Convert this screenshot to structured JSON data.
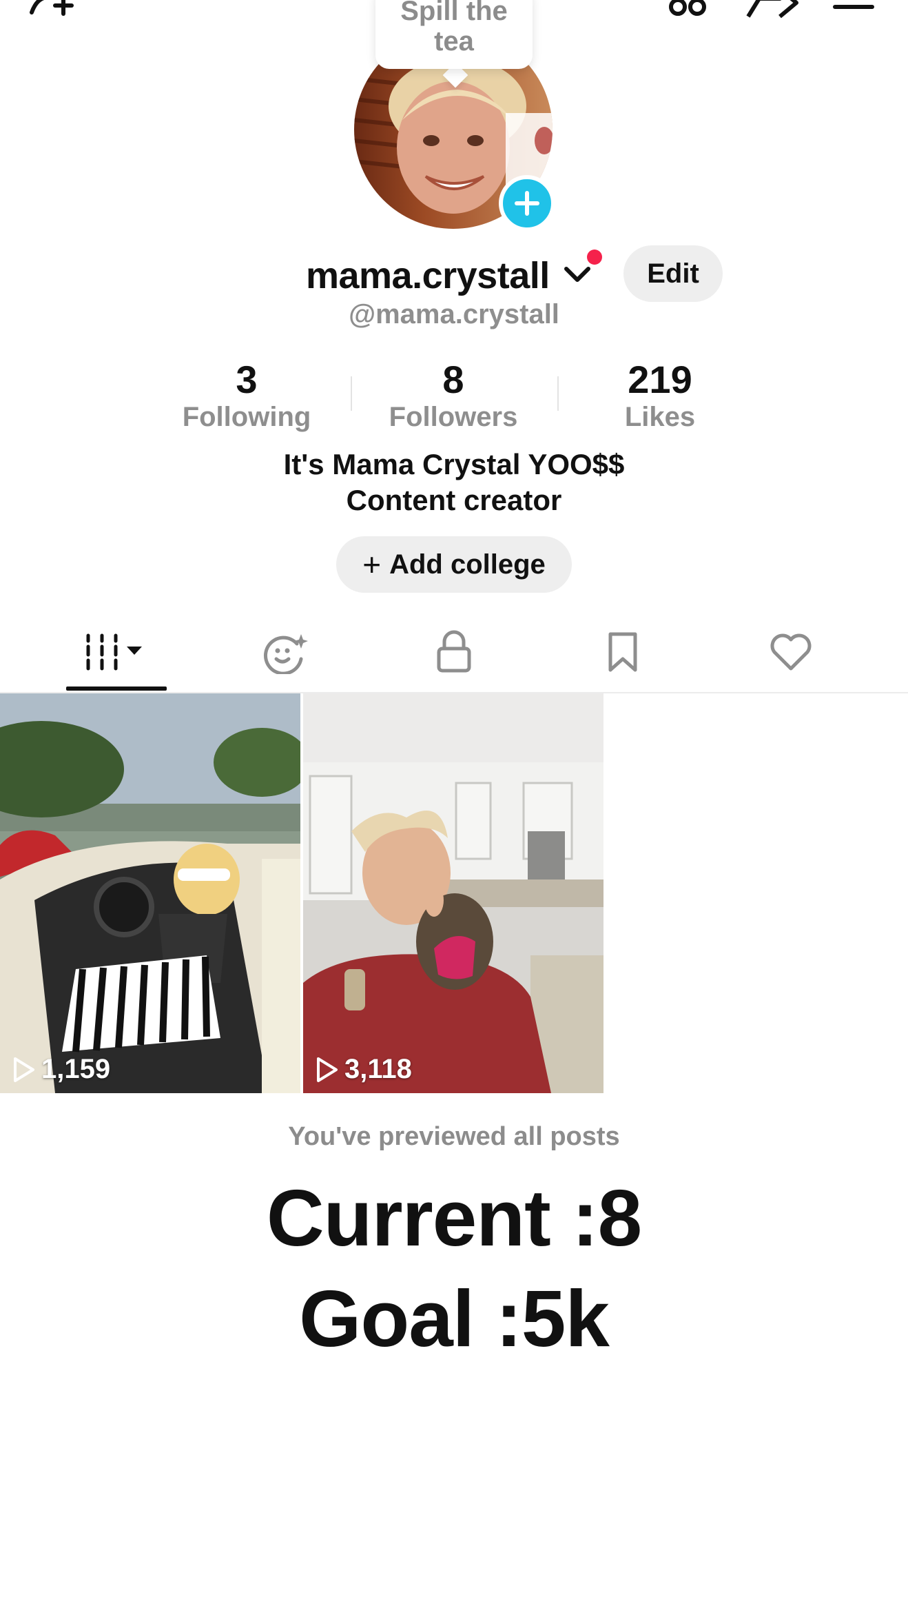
{
  "top_bar": {
    "icons": [
      "add-friend-icon",
      "creator-tools-icon",
      "share-icon",
      "menu-icon"
    ]
  },
  "note_bubble": {
    "line1": "Spill the",
    "line2": "tea"
  },
  "profile": {
    "display_name": "mama.crystall",
    "handle": "@mama.crystall",
    "edit_label": "Edit",
    "stats": {
      "following": {
        "value": "3",
        "label": "Following"
      },
      "followers": {
        "value": "8",
        "label": "Followers"
      },
      "likes": {
        "value": "219",
        "label": "Likes"
      }
    },
    "bio_line1": "It's Mama Crystal YOO$$",
    "bio_line2": "Content creator",
    "college_label": "Add college",
    "college_plus": "+"
  },
  "tabs": [
    {
      "name": "videos",
      "icon": "grid-icon",
      "active": true
    },
    {
      "name": "reposts",
      "icon": "face-sparkle-icon",
      "active": false
    },
    {
      "name": "private",
      "icon": "lock-icon",
      "active": false
    },
    {
      "name": "favorites",
      "icon": "bookmark-icon",
      "active": false
    },
    {
      "name": "liked",
      "icon": "heart-icon",
      "active": false
    }
  ],
  "posts": [
    {
      "views": "1,159"
    },
    {
      "views": "3,118"
    }
  ],
  "footer": {
    "previewed_text": "You've previewed all posts",
    "current": "Current :8",
    "goal": "Goal :5k"
  },
  "colors": {
    "accent_blue": "#20c2e8",
    "notification_red": "#f5224b",
    "muted_text": "#8e8e8e",
    "button_bg": "#eeeeee"
  }
}
